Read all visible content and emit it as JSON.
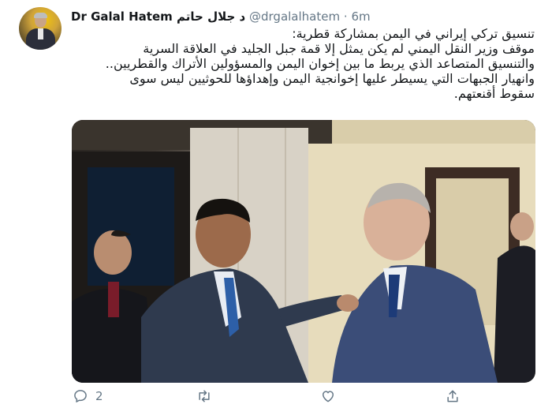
{
  "tweet": {
    "author_name": "Dr Galal Hatem د جلال حاتم",
    "handle": "@drgalalhatem",
    "separator": "·",
    "time": "6m",
    "text_lines": [
      "تنسيق تركي إيراني في اليمن بمشاركة قطرية:",
      "موقف وزير النقل اليمني لم يكن يمثل إلا قمة جبل الجليد في العلاقة السرية",
      "والتنسيق المتصاعد الذي يربط ما بين إخوان اليمن والمسؤولين الأتراك والقطريين..",
      "وانهيار الجبهات التي يسيطر عليها إخوانجية اليمن وإهداؤها للحوثيين ليس سوى",
      "سقوط أقنعتهم."
    ]
  },
  "actions": {
    "reply": {
      "icon": "reply-icon",
      "count": "2"
    },
    "retweet": {
      "icon": "retweet-icon"
    },
    "like": {
      "icon": "heart-icon"
    },
    "share": {
      "icon": "share-icon"
    }
  },
  "colors": {
    "text": "#14171a",
    "secondary": "#657786",
    "background": "#ffffff"
  }
}
